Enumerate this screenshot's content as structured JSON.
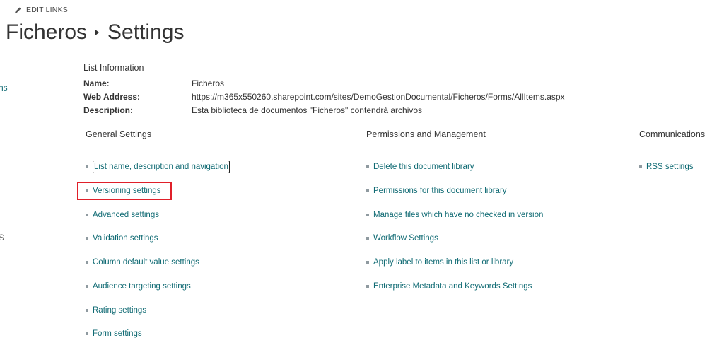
{
  "header": {
    "edit_links_label": "EDIT LINKS",
    "title_parent": "Ficheros",
    "title_current": "Settings"
  },
  "left_nav_fragments": [
    "ns",
    "S"
  ],
  "list_information": {
    "heading": "List Information",
    "name_label": "Name:",
    "name_value": "Ficheros",
    "web_address_label": "Web Address:",
    "web_address_value": "https://m365x550260.sharepoint.com/sites/DemoGestionDocumental/Ficheros/Forms/AllItems.aspx",
    "description_label": "Description:",
    "description_value": "Esta biblioteca de documentos \"Ficheros\" contendrá archivos"
  },
  "general_settings": {
    "heading": "General Settings",
    "links": [
      "List name, description and navigation",
      "Versioning settings",
      "Advanced settings",
      "Validation settings",
      "Column default value settings",
      "Audience targeting settings",
      "Rating settings",
      "Form settings"
    ]
  },
  "permissions_management": {
    "heading": "Permissions and Management",
    "links": [
      "Delete this document library",
      "Permissions for this document library",
      "Manage files which have no checked in version",
      "Workflow Settings",
      "Apply label to items in this list or library",
      "Enterprise Metadata and Keywords Settings"
    ]
  },
  "communications": {
    "heading": "Communications",
    "links": [
      "RSS settings"
    ]
  },
  "colors": {
    "link": "#0f6a73",
    "highlight": "#e0202a"
  }
}
